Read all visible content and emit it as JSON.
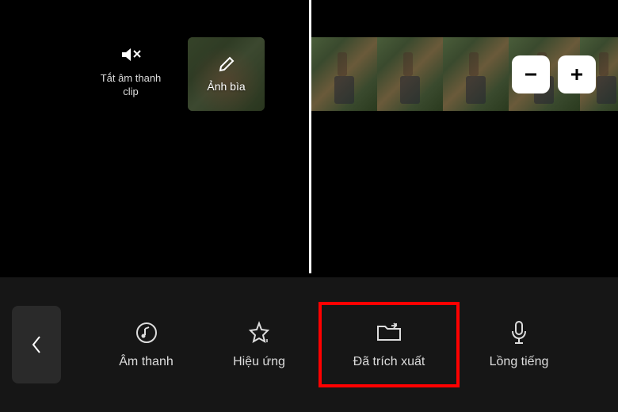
{
  "mute": {
    "label": "Tắt âm thanh clip"
  },
  "cover": {
    "label": "Ảnh bìa"
  },
  "zoom": {
    "minus": "−",
    "plus": "+"
  },
  "toolbar": {
    "back": "‹",
    "audio": "Âm thanh",
    "effects": "Hiệu ứng",
    "extract": "Đã trích xuất",
    "voice": "Lồng tiếng"
  }
}
